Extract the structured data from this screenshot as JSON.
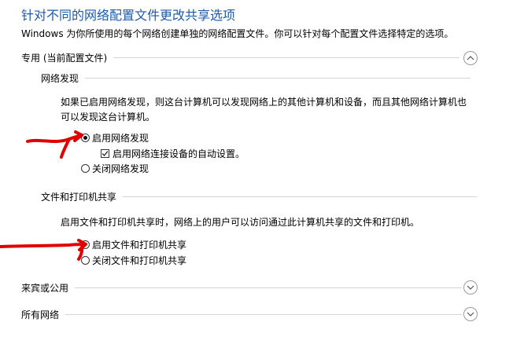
{
  "page": {
    "title": "针对不同的网络配置文件更改共享选项",
    "subtitle": "Windows 为你所使用的每个网络创建单独的网络配置文件。你可以针对每个配置文件选择特定的选项。"
  },
  "private_profile": {
    "label": "专用 (当前配置文件)",
    "expanded": true,
    "network_discovery": {
      "heading": "网络发现",
      "description_line1": "如果已启用网络发现，则这台计算机可以发现网络上的其他计算机和设备，而且其他网络计算机也",
      "description_line2": "可以发现这台计算机。",
      "options": [
        {
          "label": "启用网络发现",
          "selected": true
        },
        {
          "label": "关闭网络发现",
          "selected": false
        }
      ],
      "auto_setup_label": "启用网络连接设备的自动设置。",
      "auto_setup_checked": true
    },
    "file_printer_sharing": {
      "heading": "文件和打印机共享",
      "description": "启用文件和打印机共享时，网络上的用户可以访问通过此计算机共享的文件和打印机。",
      "options": [
        {
          "label": "启用文件和打印机共享",
          "selected": false
        },
        {
          "label": "关闭文件和打印机共享",
          "selected": false
        }
      ]
    }
  },
  "guest_public_profile": {
    "label": "来宾或公用",
    "expanded": false
  },
  "all_networks": {
    "label": "所有网络",
    "expanded": false
  },
  "colors": {
    "title": "#1e5aa8",
    "annotation": "#e00000",
    "divider": "#d4d4d4"
  },
  "icons": {
    "expanded": "chevron-up-icon",
    "collapsed": "chevron-down-icon"
  }
}
